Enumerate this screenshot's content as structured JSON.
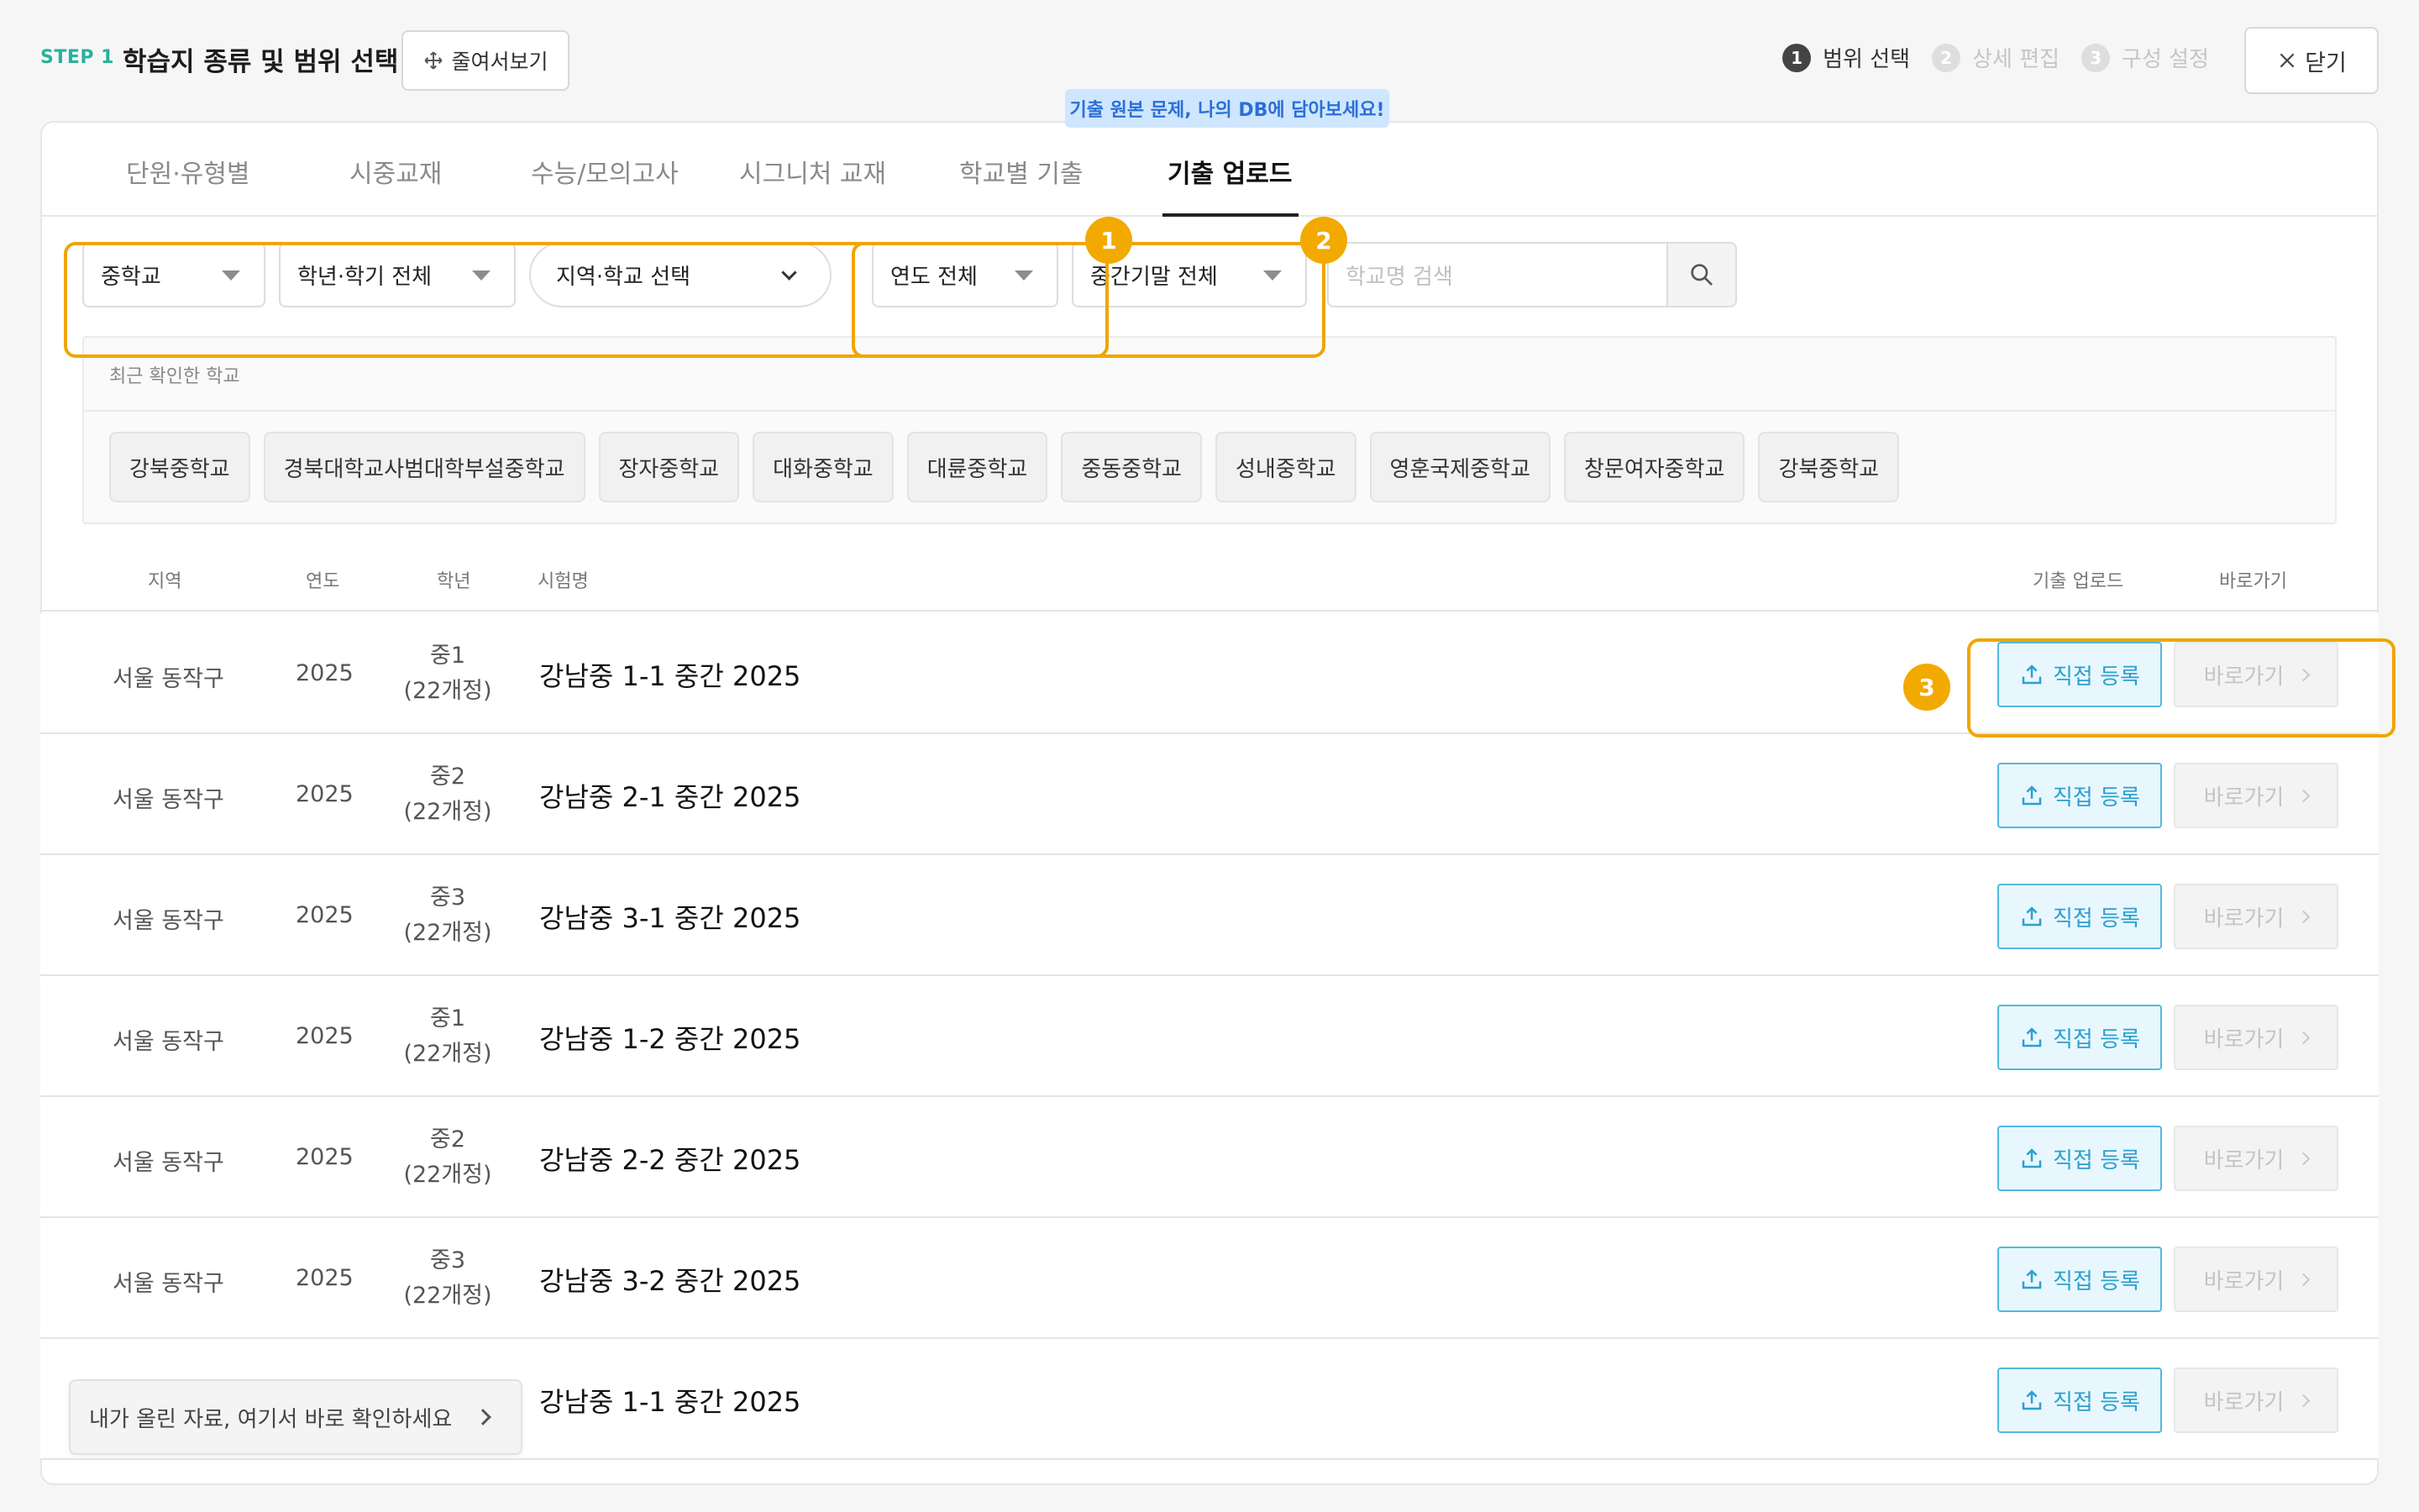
{
  "header": {
    "step_label": "STEP 1",
    "title": "학습지 종류 및 범위 선택",
    "shrink_label": "줄여서보기",
    "steps": [
      {
        "num": "1",
        "label": "범위 선택"
      },
      {
        "num": "2",
        "label": "상세 편집"
      },
      {
        "num": "3",
        "label": "구성 설정"
      }
    ],
    "close_label": "닫기"
  },
  "tooltip": "기출 원본 문제, 나의 DB에 담아보세요!",
  "tabs": [
    "단원·유형별",
    "시중교재",
    "수능/모의고사",
    "시그니처 교재",
    "학교별 기출",
    "기출 업로드"
  ],
  "filters": {
    "school_level": "중학교",
    "grade_semester": "학년·학기 전체",
    "region_school": "지역·학교 선택",
    "year": "연도 전체",
    "exam_term": "중간기말 전체",
    "search_placeholder": "학교명 검색"
  },
  "recent": {
    "title": "최근 확인한 학교",
    "schools": [
      "강북중학교",
      "경북대학교사범대학부설중학교",
      "장자중학교",
      "대화중학교",
      "대륜중학교",
      "중동중학교",
      "성내중학교",
      "영훈국제중학교",
      "창문여자중학교",
      "강북중학교"
    ]
  },
  "table": {
    "columns": {
      "region": "지역",
      "year": "연도",
      "grade": "학년",
      "exam": "시험명",
      "upload": "기출 업로드",
      "goto": "바로가기"
    },
    "rows": [
      {
        "region": "서울 동작구",
        "year": "2025",
        "grade": "중1",
        "curriculum": "(22개정)",
        "exam": "강남중 1-1 중간 2025"
      },
      {
        "region": "서울 동작구",
        "year": "2025",
        "grade": "중2",
        "curriculum": "(22개정)",
        "exam": "강남중 2-1 중간 2025"
      },
      {
        "region": "서울 동작구",
        "year": "2025",
        "grade": "중3",
        "curriculum": "(22개정)",
        "exam": "강남중 3-1 중간 2025"
      },
      {
        "region": "서울 동작구",
        "year": "2025",
        "grade": "중1",
        "curriculum": "(22개정)",
        "exam": "강남중 1-2 중간 2025"
      },
      {
        "region": "서울 동작구",
        "year": "2025",
        "grade": "중2",
        "curriculum": "(22개정)",
        "exam": "강남중 2-2 중간 2025"
      },
      {
        "region": "서울 동작구",
        "year": "2025",
        "grade": "중3",
        "curriculum": "(22개정)",
        "exam": "강남중 3-2 중간 2025"
      },
      {
        "region": "",
        "year": "",
        "grade": "",
        "curriculum": "",
        "exam": "강남중 1-1 중간 2025"
      }
    ],
    "upload_label": "직접 등록",
    "goto_label": "바로가기"
  },
  "my_banner": "내가 올린 자료, 여기서 바로 확인하세요",
  "markers": [
    "1",
    "2",
    "3"
  ],
  "colors": {
    "accent": "#27b29a",
    "highlight": "#f0a500",
    "upload": "#2ca0cf",
    "tooltip_bg": "#cfe6ff"
  }
}
